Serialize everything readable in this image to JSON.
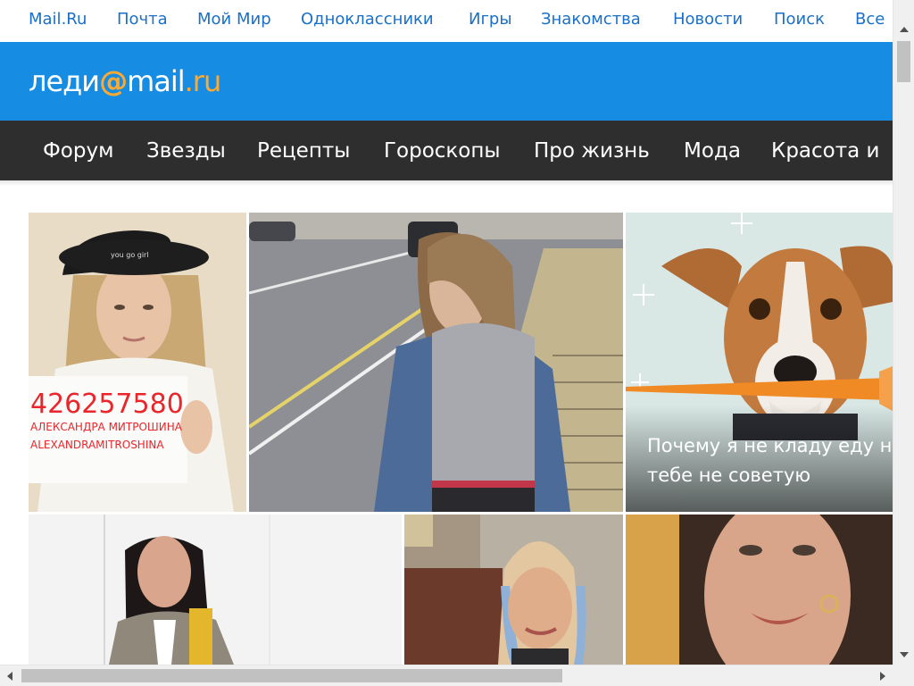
{
  "portal": {
    "links": [
      "Mail.Ru",
      "Почта",
      "Мой Мир",
      "Одноклассники",
      "Игры",
      "Знакомства",
      "Новости",
      "Поиск",
      "Все"
    ]
  },
  "brand": {
    "logo_part1": "леди",
    "logo_at": "@",
    "logo_part2": "mail",
    "logo_part3": ".ru",
    "header_color": "#168de2",
    "accent_color": "#ffa930"
  },
  "nav": {
    "items": [
      "Форум",
      "Звезды",
      "Рецепты",
      "Гороскопы",
      "Про жизнь",
      "Мода",
      "Красота и"
    ]
  },
  "tiles": {
    "sign_text_number": "426257580",
    "sign_text_line1": "АЛЕКСАНДРА МИТРОШИНА",
    "sign_text_line2": "ALEXANDRAMITROSHINA",
    "cap_text": "you go girl",
    "dog_caption_line1": "Почему я не кладу еду на",
    "dog_caption_line2": "тебе не советую"
  },
  "icons": {
    "scroll_up": "chevron-up-icon",
    "scroll_down": "chevron-down-icon",
    "scroll_left": "chevron-left-icon",
    "scroll_right": "chevron-right-icon"
  }
}
